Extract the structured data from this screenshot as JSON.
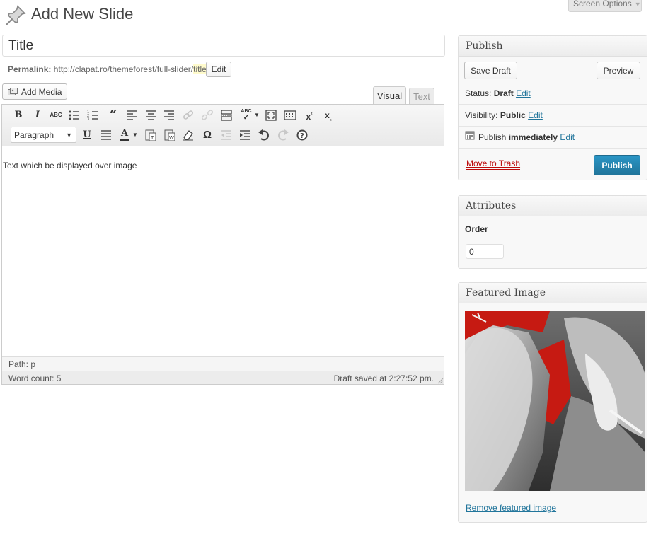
{
  "header": {
    "title": "Add New Slide",
    "screen_options_label": "Screen Options",
    "pin_icon": "pushpin-icon"
  },
  "post": {
    "title_value": "Title",
    "permalink_label": "Permalink:",
    "permalink_base": "http://clapat.ro/themeforest/full-slider/",
    "permalink_slug": "title",
    "permalink_tail": "/",
    "permalink_edit_label": "Edit"
  },
  "editor": {
    "add_media_label": "Add Media",
    "tab_visual": "Visual",
    "tab_text": "Text",
    "format_select": "Paragraph",
    "content": "Text which be displayed over image",
    "path_label": "Path: p",
    "word_count": "Word count: 5",
    "draft_saved": "Draft saved at 2:27:52 pm.",
    "toolbar_row1": [
      "bold",
      "italic",
      "strikethrough",
      "bullet-list",
      "numbered-list",
      "blockquote",
      "align-left",
      "align-center",
      "align-right",
      "insert-link",
      "unlink",
      "insert-more",
      "spellcheck",
      "fullscreen",
      "kitchen-sink",
      "superscript",
      "subscript"
    ],
    "toolbar_row2": [
      "underline",
      "justify",
      "text-color",
      "paste-text",
      "paste-word",
      "clear-formatting",
      "special-character",
      "outdent",
      "indent",
      "undo",
      "redo",
      "help"
    ]
  },
  "publish": {
    "heading": "Publish",
    "save_draft_label": "Save Draft",
    "preview_label": "Preview",
    "status_label": "Status:",
    "status_value": "Draft",
    "visibility_label": "Visibility:",
    "visibility_value": "Public",
    "publish_label": "Publish",
    "publish_value": "immediately",
    "edit_label": "Edit",
    "move_to_trash_label": "Move to Trash",
    "publish_button_label": "Publish"
  },
  "attributes": {
    "heading": "Attributes",
    "order_label": "Order",
    "order_value": "0"
  },
  "featured": {
    "heading": "Featured Image",
    "remove_label": "Remove featured image"
  },
  "colors": {
    "link": "#21759b",
    "publish_button": "#21759b",
    "trash": "#bc0b0b",
    "highlight": "#fffbcc"
  }
}
